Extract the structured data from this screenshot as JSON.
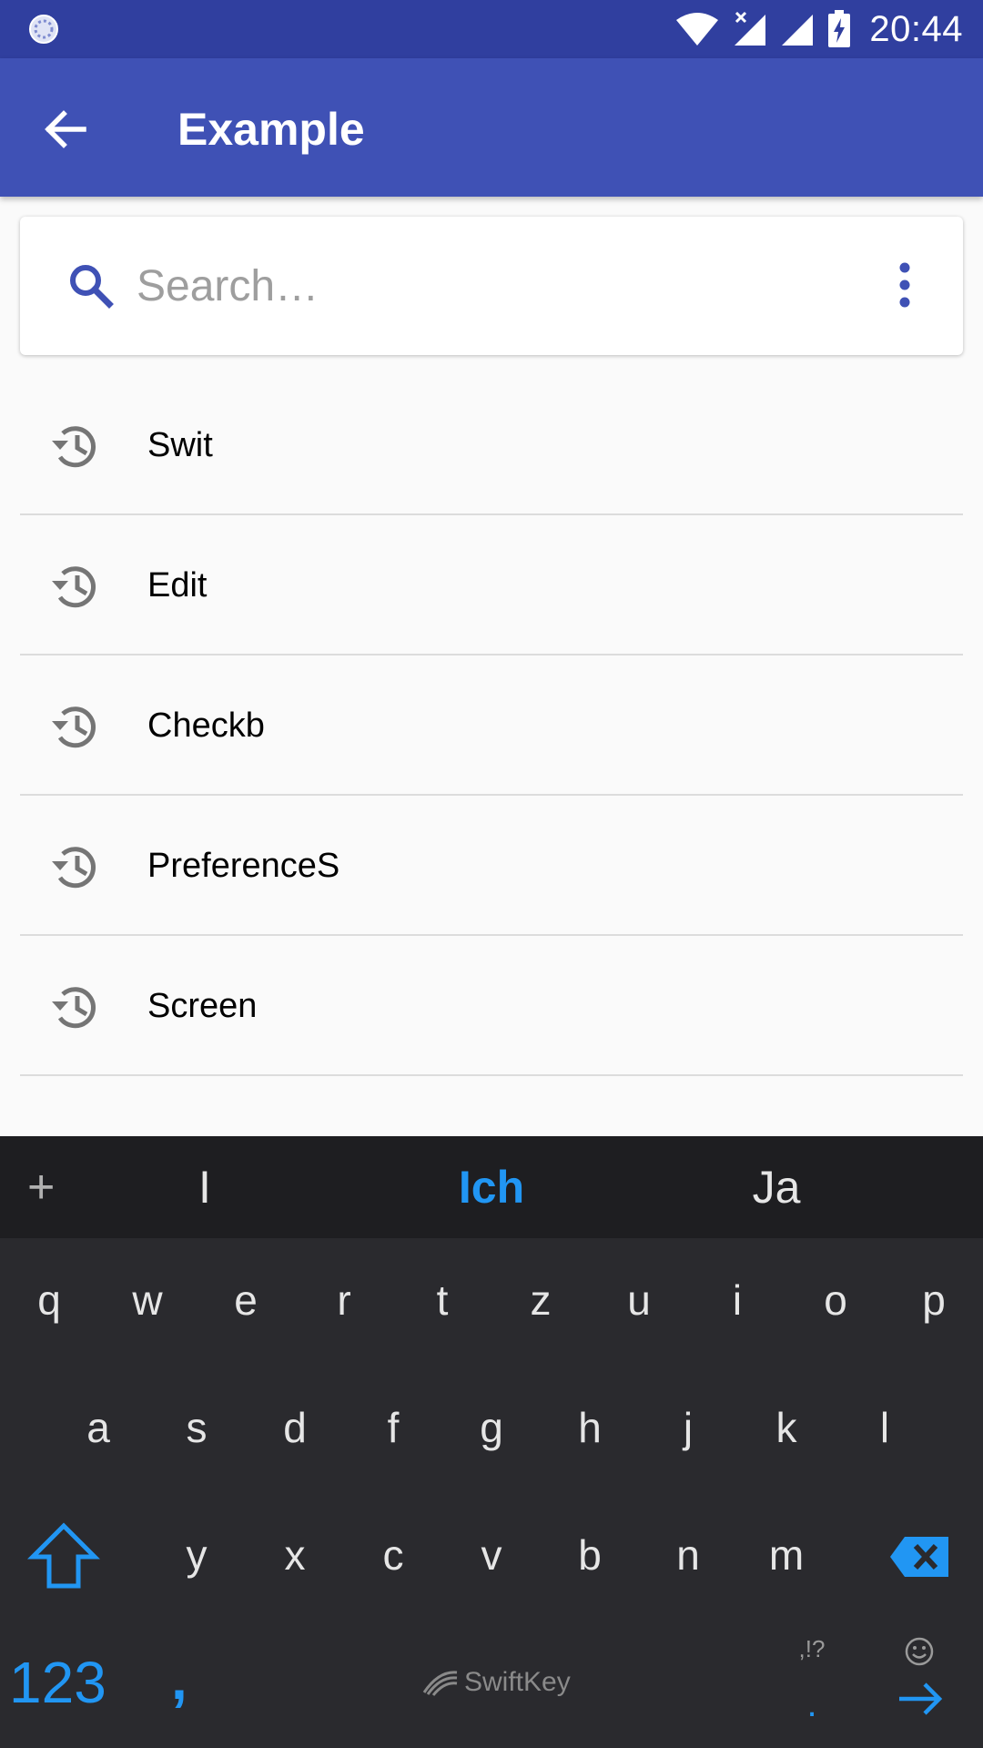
{
  "status_bar": {
    "time": "20:44",
    "icons": [
      "app-indicator-icon",
      "wifi-icon",
      "no-signal-icon",
      "signal-icon",
      "battery-charging-icon"
    ]
  },
  "app_bar": {
    "title": "Example",
    "back_icon": "arrow-left-icon"
  },
  "search": {
    "placeholder": "Search…",
    "value": "",
    "icon": "search-icon",
    "menu_icon": "more-vert-icon"
  },
  "history": {
    "icon": "history-icon",
    "items": [
      {
        "label": "Swit"
      },
      {
        "label": "Edit"
      },
      {
        "label": "Checkb"
      },
      {
        "label": "PreferenceS"
      },
      {
        "label": "Screen"
      }
    ]
  },
  "keyboard": {
    "suggestions": {
      "plus": "+",
      "items": [
        "I",
        "Ich",
        "Ja"
      ],
      "selected": "Ich"
    },
    "row1": [
      "q",
      "w",
      "e",
      "r",
      "t",
      "z",
      "u",
      "i",
      "o",
      "p"
    ],
    "row2": [
      "a",
      "s",
      "d",
      "f",
      "g",
      "h",
      "j",
      "k",
      "l"
    ],
    "row3": [
      "y",
      "x",
      "c",
      "v",
      "b",
      "n",
      "m"
    ],
    "bottom": {
      "numbers": "123",
      "comma": ",",
      "brand": "SwiftKey",
      "punct": ",!?",
      "period": "."
    },
    "accent_color": "#2196f3"
  },
  "colors": {
    "status_bar": "#303f9f",
    "app_bar": "#3f51b5",
    "search_icon": "#3f51b5",
    "keyboard_bg": "#2a2a2e"
  }
}
